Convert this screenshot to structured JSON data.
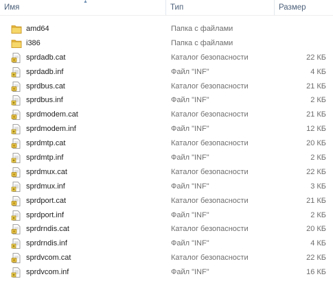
{
  "header": {
    "name": "Имя",
    "type": "Тип",
    "size": "Размер"
  },
  "files": [
    {
      "name": "amd64",
      "type": "Папка с файлами",
      "size": "",
      "icon": "folder-icon"
    },
    {
      "name": "i386",
      "type": "Папка с файлами",
      "size": "",
      "icon": "folder-icon"
    },
    {
      "name": "sprdadb.cat",
      "type": "Каталог безопасности",
      "size": "22 КБ",
      "icon": "cat-file-icon"
    },
    {
      "name": "sprdadb.inf",
      "type": "Файл \"INF\"",
      "size": "4 КБ",
      "icon": "inf-file-icon"
    },
    {
      "name": "sprdbus.cat",
      "type": "Каталог безопасности",
      "size": "21 КБ",
      "icon": "cat-file-icon"
    },
    {
      "name": "sprdbus.inf",
      "type": "Файл \"INF\"",
      "size": "2 КБ",
      "icon": "inf-file-icon"
    },
    {
      "name": "sprdmodem.cat",
      "type": "Каталог безопасности",
      "size": "21 КБ",
      "icon": "cat-file-icon"
    },
    {
      "name": "sprdmodem.inf",
      "type": "Файл \"INF\"",
      "size": "12 КБ",
      "icon": "inf-file-icon"
    },
    {
      "name": "sprdmtp.cat",
      "type": "Каталог безопасности",
      "size": "20 КБ",
      "icon": "cat-file-icon"
    },
    {
      "name": "sprdmtp.inf",
      "type": "Файл \"INF\"",
      "size": "2 КБ",
      "icon": "inf-file-icon"
    },
    {
      "name": "sprdmux.cat",
      "type": "Каталог безопасности",
      "size": "22 КБ",
      "icon": "cat-file-icon"
    },
    {
      "name": "sprdmux.inf",
      "type": "Файл \"INF\"",
      "size": "3 КБ",
      "icon": "inf-file-icon"
    },
    {
      "name": "sprdport.cat",
      "type": "Каталог безопасности",
      "size": "21 КБ",
      "icon": "cat-file-icon"
    },
    {
      "name": "sprdport.inf",
      "type": "Файл \"INF\"",
      "size": "2 КБ",
      "icon": "inf-file-icon"
    },
    {
      "name": "sprdrndis.cat",
      "type": "Каталог безопасности",
      "size": "20 КБ",
      "icon": "cat-file-icon"
    },
    {
      "name": "sprdrndis.inf",
      "type": "Файл \"INF\"",
      "size": "4 КБ",
      "icon": "inf-file-icon"
    },
    {
      "name": "sprdvcom.cat",
      "type": "Каталог безопасности",
      "size": "22 КБ",
      "icon": "cat-file-icon"
    },
    {
      "name": "sprdvcom.inf",
      "type": "Файл \"INF\"",
      "size": "16 КБ",
      "icon": "inf-file-icon"
    }
  ]
}
